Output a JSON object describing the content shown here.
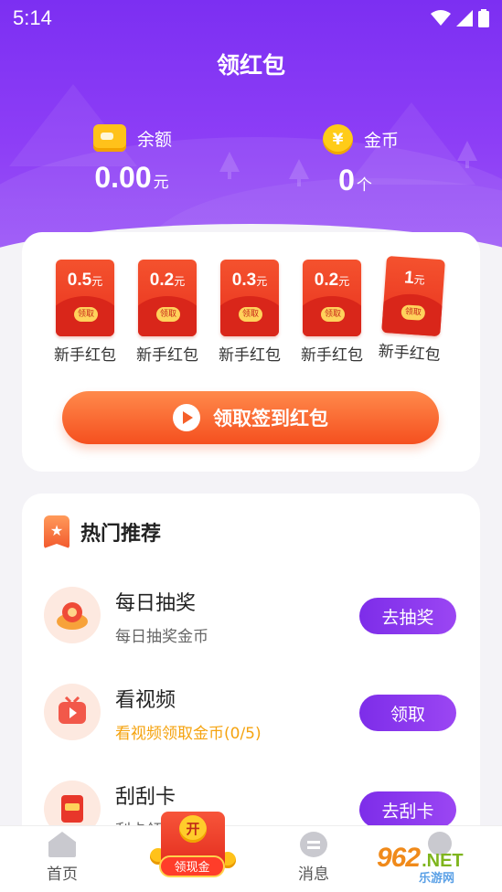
{
  "status_bar": {
    "time": "5:14"
  },
  "page_title": "领红包",
  "balance": {
    "label": "余额",
    "value": "0.00",
    "unit": "元"
  },
  "coins": {
    "label": "金币",
    "value": "0",
    "unit": "个",
    "icon_symbol": "¥"
  },
  "packets": [
    {
      "amount": "0.5",
      "unit": "元",
      "seal": "领取",
      "label": "新手红包"
    },
    {
      "amount": "0.2",
      "unit": "元",
      "seal": "领取",
      "label": "新手红包"
    },
    {
      "amount": "0.3",
      "unit": "元",
      "seal": "领取",
      "label": "新手红包"
    },
    {
      "amount": "0.2",
      "unit": "元",
      "seal": "领取",
      "label": "新手红包"
    },
    {
      "amount": "1",
      "unit": "元",
      "seal": "领取",
      "label": "新手红包"
    }
  ],
  "sign_button_label": "领取签到红包",
  "recommend": {
    "title": "热门推荐",
    "tasks": [
      {
        "title": "每日抽奖",
        "subtitle": "每日抽奖金币",
        "button": "去抽奖"
      },
      {
        "title": "看视频",
        "subtitle": "看视频领取金币(0/5)",
        "button": "领取"
      },
      {
        "title": "刮刮卡",
        "subtitle": "刮卡领",
        "button": "去刮卡"
      }
    ]
  },
  "bottom_nav": {
    "home": "首页",
    "center_coin": "开",
    "center_label": "领现金",
    "messages": "消息"
  },
  "watermark": {
    "main": "962",
    "net": ".NET",
    "sub": "乐游网"
  },
  "colors": {
    "primary_purple": "#7c2ff2",
    "accent_orange": "#f5501f",
    "red_packet": "#e8311e"
  }
}
